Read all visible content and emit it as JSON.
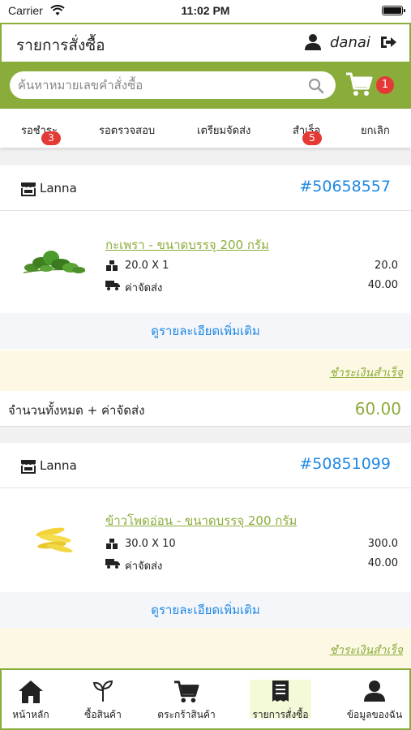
{
  "status_bar": {
    "carrier": "Carrier",
    "time": "11:02 PM"
  },
  "header": {
    "title": "รายการสั่งซื้อ",
    "username": "danai"
  },
  "search": {
    "placeholder": "ค้นหาหมายเลขคำสั่งซื้อ",
    "cart_count": "1"
  },
  "tabs": [
    {
      "label": "รอชำระ",
      "badge": "3"
    },
    {
      "label": "รอตรวจสอบ",
      "badge": ""
    },
    {
      "label": "เตรียมจัดส่ง",
      "badge": ""
    },
    {
      "label": "สำเร็จ",
      "badge": "5"
    },
    {
      "label": "ยกเลิก",
      "badge": ""
    }
  ],
  "orders": [
    {
      "store": "Lanna",
      "order_no": "#50658557",
      "product_name": "กะเพรา - ขนาดบรรจุ 200 กรัม",
      "qty_label": "20.0 X 1",
      "qty_value": "20.0",
      "shipping_label": "ค่าจัดส่ง",
      "shipping_value": "40.00",
      "details_label": "ดูรายละเอียดเพิ่มเติม",
      "status": "ชำระเงินสำเร็จ",
      "total_label": "จำนวนทั้งหมด + ค่าจัดส่ง",
      "total_value": "60.00"
    },
    {
      "store": "Lanna",
      "order_no": "#50851099",
      "product_name": "ข้าวโพดอ่อน - ขนาดบรรจุ 200 กรัม",
      "qty_label": "30.0 X 10",
      "qty_value": "300.0",
      "shipping_label": "ค่าจัดส่ง",
      "shipping_value": "40.00",
      "details_label": "ดูรายละเอียดเพิ่มเติม",
      "status": "ชำระเงินสำเร็จ"
    }
  ],
  "bottom_nav": [
    {
      "label": "หน้าหลัก",
      "icon": "home-icon"
    },
    {
      "label": "ซื้อสินค้า",
      "icon": "sprout-icon"
    },
    {
      "label": "ตระกร้าสินค้า",
      "icon": "cart-icon"
    },
    {
      "label": "รายการสั่งซื้อ",
      "icon": "receipt-icon",
      "active": true
    },
    {
      "label": "ข้อมูลของฉัน",
      "icon": "user-icon"
    }
  ],
  "colors": {
    "accent": "#8aac3a",
    "link": "#1e88e5",
    "badge": "#e53935"
  }
}
